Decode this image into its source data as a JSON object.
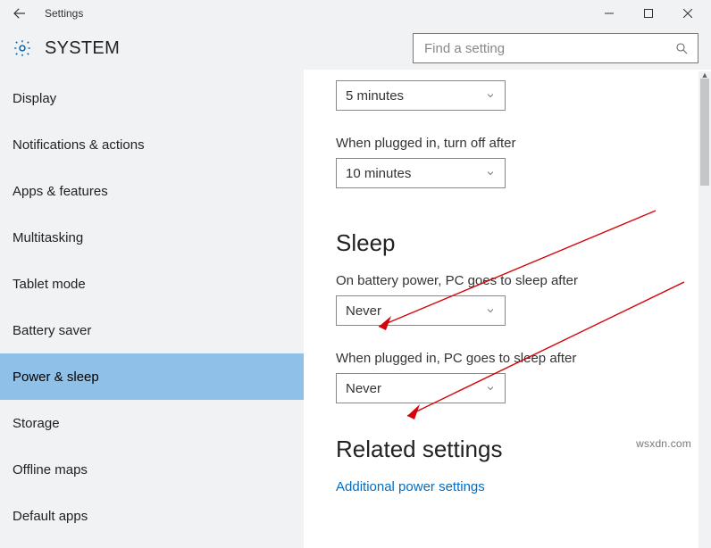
{
  "titlebar": {
    "title": "Settings"
  },
  "header": {
    "title": "SYSTEM",
    "search_placeholder": "Find a setting"
  },
  "sidebar": {
    "items": [
      {
        "label": "Display"
      },
      {
        "label": "Notifications & actions"
      },
      {
        "label": "Apps & features"
      },
      {
        "label": "Multitasking"
      },
      {
        "label": "Tablet mode"
      },
      {
        "label": "Battery saver"
      },
      {
        "label": "Power & sleep"
      },
      {
        "label": "Storage"
      },
      {
        "label": "Offline maps"
      },
      {
        "label": "Default apps"
      }
    ],
    "selected_index": 6
  },
  "content": {
    "screen_off_battery_value": "5 minutes",
    "screen_off_plugged_label": "When plugged in, turn off after",
    "screen_off_plugged_value": "10 minutes",
    "sleep_heading": "Sleep",
    "sleep_battery_label": "On battery power, PC goes to sleep after",
    "sleep_battery_value": "Never",
    "sleep_plugged_label": "When plugged in, PC goes to sleep after",
    "sleep_plugged_value": "Never",
    "related_heading": "Related settings",
    "additional_link": "Additional power settings"
  },
  "watermark": "wsxdn.com"
}
